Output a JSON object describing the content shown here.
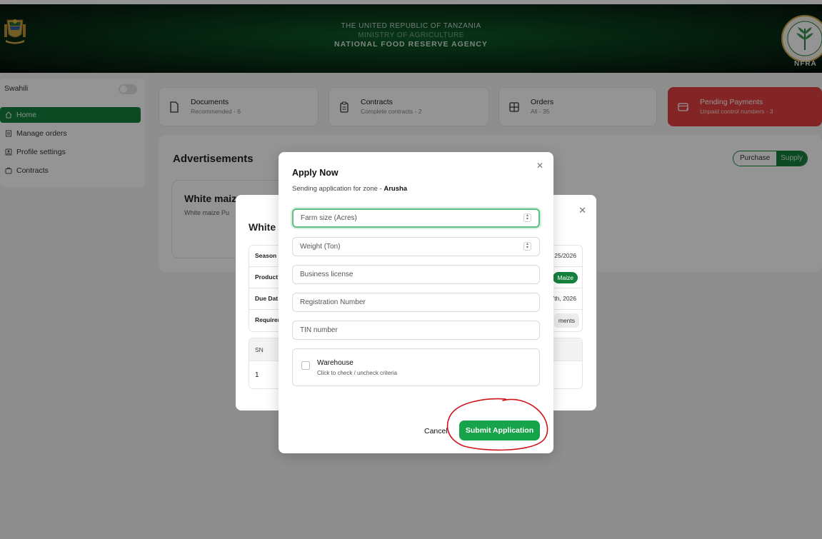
{
  "header": {
    "line1": "THE UNITED REPUBLIC OF TANZANIA",
    "line2": "MINISTRY OF AGRICULTURE",
    "line3": "NATIONAL FOOD RESERVE AGENCY",
    "logo_text": "NFRA"
  },
  "sidebar": {
    "language_label": "Swahili",
    "items": [
      {
        "label": "Home",
        "icon": "home-icon",
        "active": true
      },
      {
        "label": "Manage orders",
        "icon": "orders-icon",
        "active": false
      },
      {
        "label": "Profile settings",
        "icon": "profile-icon",
        "active": false
      },
      {
        "label": "Contracts",
        "icon": "contracts-icon",
        "active": false
      }
    ]
  },
  "stats": [
    {
      "title": "Documents",
      "sub": "Recommended - 6",
      "icon": "document-icon"
    },
    {
      "title": "Contracts",
      "sub": "Complete contracts - 2",
      "icon": "clipboard-icon"
    },
    {
      "title": "Orders",
      "sub": "All - 35",
      "icon": "grid-icon"
    },
    {
      "title": "Pending Payments",
      "sub": "Unpaid control numbers - 3",
      "icon": "card-icon"
    }
  ],
  "ads": {
    "title": "Advertisements",
    "toggle_purchase": "Purchase",
    "toggle_supply": "Supply",
    "card_title": "White maiz",
    "card_desc": "White maize Pu"
  },
  "detail_modal": {
    "title": "White",
    "rows": [
      {
        "key": "Season",
        "value": "25/2026"
      },
      {
        "key": "Product",
        "value": "Maize"
      },
      {
        "key": "Due Dat",
        "value": "7th, 2026"
      },
      {
        "key": "Requirer",
        "value": "ments"
      }
    ],
    "sn_header": "SN",
    "sn_value": "1"
  },
  "apply_modal": {
    "title": "Apply Now",
    "subtitle_prefix": "Sending application for zone - ",
    "zone": "Arusha",
    "fields": {
      "farm_size": "Farm size (Acres)",
      "weight": "Weight (Ton)",
      "business_license": "Business license",
      "registration_number": "Registration Number",
      "tin_number": "TIN number"
    },
    "criteria_title": "Warehouse",
    "criteria_hint": "Click to check / uncheck criteria",
    "cancel_label": "Cancel",
    "submit_label": "Submit Application"
  },
  "colors": {
    "primary": "#15803d",
    "submit": "#16a34a",
    "danger": "#e0403f",
    "annotation": "#d0141c"
  }
}
